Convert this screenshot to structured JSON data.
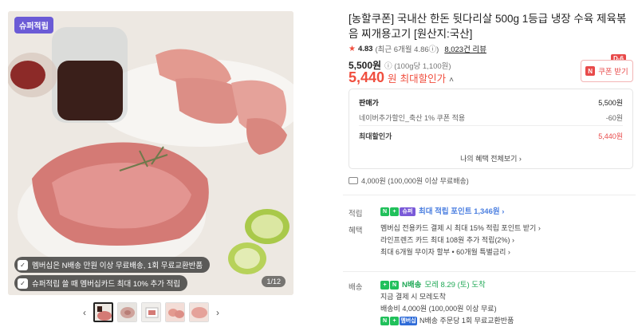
{
  "gallery": {
    "badge": "슈퍼적립",
    "overlay_1": "멤버십은 N배송 만원 이상 무료배송, 1회 무료교환반품",
    "overlay_2": "슈퍼적립 쓸 때 멤버십카드 최대 10% 추가 적립",
    "counter": "1/12",
    "prev_arrow": "‹",
    "next_arrow": "›"
  },
  "product": {
    "title": "[농할쿠폰] 국내산 한돈 뒷다리살 500g 1등급 냉장 수육 제육볶음 찌개용고기 [원산지:국산]",
    "rating_score": "4.83",
    "rating_detail": "(최근 6개월 4.86ⓘ)",
    "reviews": "8,023건 리뷰",
    "original_price": "5,500원",
    "unit_price": "ⓘ (100g당 1,100원)",
    "max_discount_price": "5,440",
    "won": "원",
    "max_discount_label": "최대할인가",
    "caret": "˄"
  },
  "coupon": {
    "dday": "D-6",
    "label": "쿠폰 받기",
    "icon": "N"
  },
  "breakdown": {
    "sale_price_label": "판매가",
    "sale_price_value": "5,500원",
    "extra_label": "네이버추가할인_축산 1% 쿠폰 적용",
    "extra_value": "-60원",
    "max_label": "최대할인가",
    "max_value": "5,440원",
    "benefits_link": "나의 혜택 전체보기 ›"
  },
  "shipping": {
    "text": "4,000원 (100,000원 이상 무료배송)"
  },
  "points": {
    "label": "적립",
    "text": "최대 적립 포인트 1,346원 ›",
    "chip_n": "N",
    "chip_plus": "+",
    "chip_super": "슈퍼"
  },
  "benefits": {
    "label": "혜택",
    "lines": [
      "멤버십 전용카드 결제 시 최대 15% 적립 포인트 받기 ›",
      "라인프렌즈 카드 최대 108원 추가 적립(2%) ›",
      "최대 6개월 무이자 할부 • 60개월 특별금리 ›"
    ]
  },
  "delivery": {
    "label": "배송",
    "head": "N배송",
    "head_sub": "모레 8.29 (토) 도착",
    "lines": [
      "지금 결제 시 모레도착",
      "배송비 4,000원 (100,000원 이상 무료)",
      "N배송 주문당 1회 무료교환반품"
    ],
    "member_chip": "멤버십"
  },
  "colors": {
    "accent_red": "#f04e3e",
    "naver_green": "#21c05b",
    "super_purple": "#6b5bd6",
    "points_blue": "#4a7ee0"
  }
}
